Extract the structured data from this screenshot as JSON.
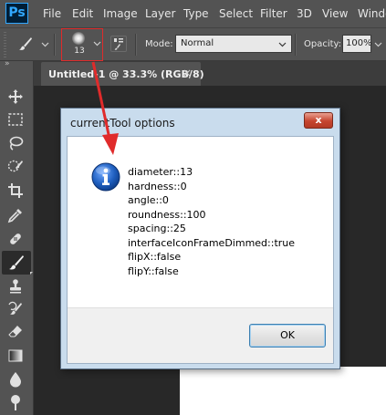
{
  "menubar": {
    "logo": "Ps",
    "items": [
      "File",
      "Edit",
      "Image",
      "Layer",
      "Type",
      "Select",
      "Filter",
      "3D",
      "View",
      "Windo"
    ]
  },
  "optionsbar": {
    "brush_size": "13",
    "mode_label": "Mode:",
    "mode_value": "Normal",
    "opacity_label": "Opacity:",
    "opacity_value": "100%"
  },
  "document_tab": {
    "title": "Untitled-1 @ 33.3% (RGB/8)",
    "close": "×"
  },
  "toolbar": {
    "collapse": "»",
    "tools": [
      "move-tool",
      "marquee-tool",
      "lasso-tool",
      "quick-selection-tool",
      "crop-tool",
      "eyedropper-tool",
      "healing-brush-tool",
      "brush-tool",
      "clone-stamp-tool",
      "history-brush-tool",
      "eraser-tool",
      "gradient-tool",
      "blur-tool",
      "dodge-tool"
    ],
    "active": "brush-tool"
  },
  "dialog": {
    "title": "currentTool options",
    "close": "x",
    "icon": "info-icon",
    "lines": [
      "diameter::13",
      "hardness::0",
      "angle::0",
      "roundness::100",
      "spacing::25",
      "interfaceIconFrameDimmed::true",
      "flipX::false",
      "flipY::false"
    ],
    "ok_label": "OK"
  },
  "colors": {
    "ps_bg": "#535353",
    "canvas_bg": "#282828",
    "dialog_frame": "#c9dced",
    "annotation": "#e02b2b",
    "info_blue": "#1f5fbf"
  }
}
